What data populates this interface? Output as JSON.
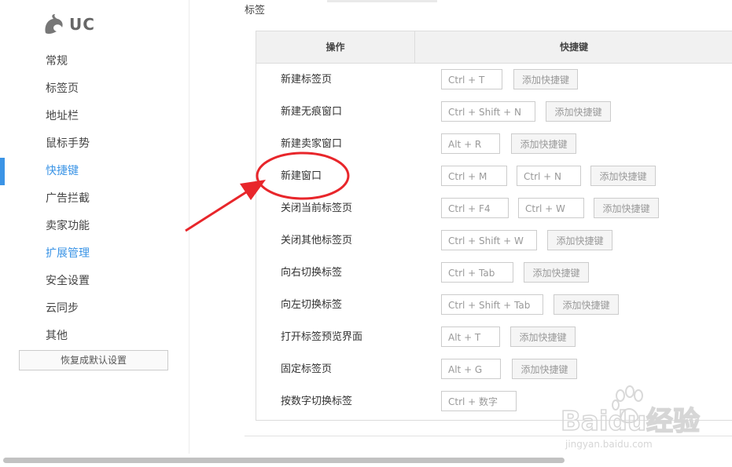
{
  "app": {
    "logo_text": "UC"
  },
  "sidebar": {
    "items": [
      {
        "label": "常规"
      },
      {
        "label": "标签页"
      },
      {
        "label": "地址栏"
      },
      {
        "label": "鼠标手势"
      },
      {
        "label": "快捷键"
      },
      {
        "label": "广告拦截"
      },
      {
        "label": "卖家功能"
      },
      {
        "label": "扩展管理"
      },
      {
        "label": "安全设置"
      },
      {
        "label": "云同步"
      },
      {
        "label": "其他"
      }
    ],
    "active_item": "快捷键",
    "reset_label": "恢复成默认设置"
  },
  "main": {
    "section_title": "标签",
    "table": {
      "col_operation": "操作",
      "col_shortcut": "快捷键",
      "rows": [
        {
          "name": "新建标签页",
          "keys": [
            "Ctrl + T"
          ],
          "add": "添加快捷键"
        },
        {
          "name": "新建无痕窗口",
          "keys": [
            "Ctrl + Shift + N"
          ],
          "add": "添加快捷键"
        },
        {
          "name": "新建卖家窗口",
          "keys": [
            "Alt + R"
          ],
          "add": "添加快捷键"
        },
        {
          "name": "新建窗口",
          "keys": [
            "Ctrl + M",
            "Ctrl + N"
          ],
          "add": "添加快捷键"
        },
        {
          "name": "关闭当前标签页",
          "keys": [
            "Ctrl + F4",
            "Ctrl + W"
          ],
          "add": "添加快捷键"
        },
        {
          "name": "关闭其他标签页",
          "keys": [
            "Ctrl + Shift + W"
          ],
          "add": "添加快捷键"
        },
        {
          "name": "向右切换标签",
          "keys": [
            "Ctrl + Tab"
          ],
          "add": "添加快捷键"
        },
        {
          "name": "向左切换标签",
          "keys": [
            "Ctrl + Shift + Tab"
          ],
          "add": "添加快捷键"
        },
        {
          "name": "打开标签预览界面",
          "keys": [
            "Alt + T"
          ],
          "add": "添加快捷键"
        },
        {
          "name": "固定标签页",
          "keys": [
            "Alt + G"
          ],
          "add": "添加快捷键"
        },
        {
          "name": "按数字切换标签",
          "keys": [
            "Ctrl + 数字"
          ],
          "add": ""
        }
      ]
    }
  },
  "watermark": {
    "line1": "Baidu经验",
    "line2": "jingyan.baidu.com"
  },
  "colors": {
    "accent": "#3b94e6",
    "annotation": "#e8262b"
  }
}
